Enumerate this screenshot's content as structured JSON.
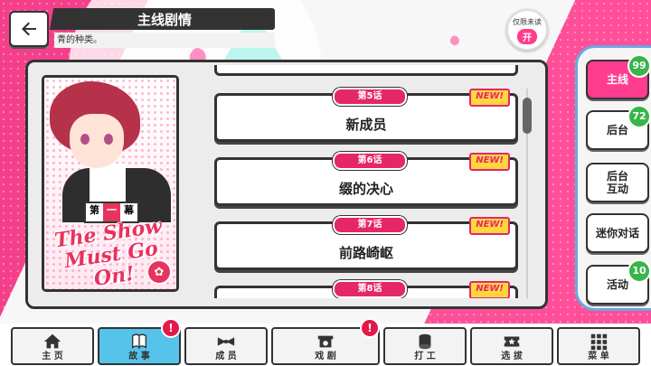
{
  "header": {
    "title": "主线剧情",
    "subtitle": "青的种类。",
    "unread_label": "仅限未读",
    "unread_state": "开"
  },
  "card": {
    "act_prefix": "第",
    "act_number": "一",
    "act_suffix": "幕",
    "title": "The Show Must Go On!"
  },
  "episodes": [
    {
      "tag": "第5话",
      "title": "新成员",
      "new": "NEW!"
    },
    {
      "tag": "第6话",
      "title": "缀的决心",
      "new": "NEW!"
    },
    {
      "tag": "第7话",
      "title": "前路崎岖",
      "new": "NEW!"
    },
    {
      "tag": "第8话",
      "title": "",
      "new": "NEW!"
    }
  ],
  "sidebar": [
    {
      "label": "主线",
      "badge": "99",
      "active": true
    },
    {
      "label": "后台",
      "badge": "72",
      "active": false
    },
    {
      "label": "后台\n互动",
      "badge": "",
      "active": false
    },
    {
      "label": "迷你对话",
      "badge": "",
      "active": false
    },
    {
      "label": "活动",
      "badge": "10",
      "active": false
    }
  ],
  "nav": [
    {
      "label": "主 页",
      "icon": "home-icon"
    },
    {
      "label": "故 事",
      "icon": "book-icon",
      "active": true,
      "alert": "!"
    },
    {
      "label": "成 员",
      "icon": "bowtie-icon"
    },
    {
      "label": "戏 剧",
      "icon": "theater-icon",
      "alert": "!"
    },
    {
      "label": "打 工",
      "icon": "coins-icon"
    },
    {
      "label": "选 拔",
      "icon": "ticket-icon"
    },
    {
      "label": "菜 单",
      "icon": "grid-menu-icon"
    }
  ],
  "colors": {
    "accent": "#ff3c8e",
    "tag": "#e52767",
    "badge": "#39b54a",
    "nav_active": "#55c3ea"
  }
}
